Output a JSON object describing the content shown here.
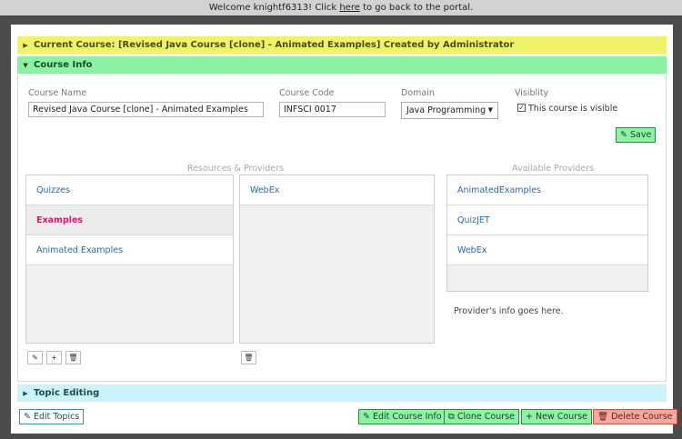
{
  "topbar": {
    "prefix": "Welcome knightf6313! Click ",
    "link": "here",
    "suffix": " to go back to the portal."
  },
  "course_bar": {
    "label": "Current Course: [Revised Java Course [clone] - Animated Examples] Created by Administrator"
  },
  "info_bar": {
    "label": "Course Info"
  },
  "topic_bar": {
    "label": "Topic Editing"
  },
  "form": {
    "course_name_label": "Course Name",
    "course_name_value": "Revised Java Course [clone] - Animated Examples",
    "course_code_label": "Course Code",
    "course_code_value": "INFSCI 0017",
    "domain_label": "Domain",
    "domain_value": "Java Programming",
    "visibility_label": "Visiblity",
    "visibility_checkbox_label": "This course is visible",
    "save_label": "Save"
  },
  "resources": {
    "header": "Resources & Providers",
    "items": [
      "Quizzes",
      "Examples",
      "Animated Examples"
    ],
    "selected": "Examples",
    "providers": [
      "WebEx"
    ]
  },
  "available": {
    "header": "Available Providers",
    "items": [
      "AnimatedExamples",
      "QuizJET",
      "WebEx"
    ],
    "info": "Provider's info goes here."
  },
  "footer": {
    "edit_topics": "Edit Topics",
    "edit_course_info": "Edit Course Info",
    "clone_course": "Clone Course",
    "new_course": "New Course",
    "delete_course": "Delete Course"
  },
  "colors": {
    "course_bar": "#eef36a",
    "info_bar": "#8cf3a4",
    "topic_bar": "#ccf3f9",
    "delete": "#f7a9a0"
  }
}
